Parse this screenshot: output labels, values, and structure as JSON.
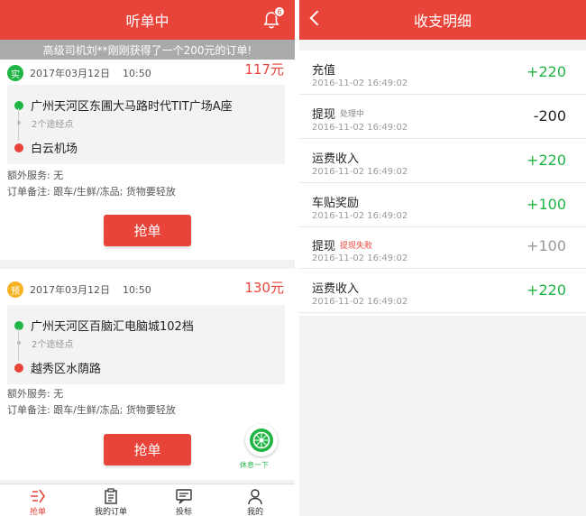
{
  "left": {
    "header_title": "听单中",
    "bell_badge": "6",
    "notice": "高级司机刘**刚刚获得了一个200元的订单!",
    "orders": [
      {
        "tag": "实",
        "tag_color": "#1fb544",
        "date": "2017年03月12日",
        "time": "10:50",
        "price": "117元",
        "from": "广州天河区东圃大马路时代TIT广场A座",
        "via": "2个途经点",
        "to": "白云机场",
        "extra_service_label": "额外服务:",
        "extra_service": "无",
        "note_label": "订单备注:",
        "note": "跟车/生鲜/冻品; 货物要轻放",
        "grab_label": "抢单"
      },
      {
        "tag": "预",
        "tag_color": "#f5b324",
        "date": "2017年03月12日",
        "time": "10:50",
        "price": "130元",
        "from": "广州天河区百脑汇电脑城102档",
        "via": "2个途经点",
        "to": "越秀区水荫路",
        "extra_service_label": "额外服务:",
        "extra_service": "无",
        "note_label": "订单备注:",
        "note": "跟车/生鲜/冻品; 货物要轻放",
        "grab_label": "抢单"
      }
    ],
    "rest_label": "休息一下",
    "tabs": [
      {
        "label": "抢单",
        "icon": "grab-order-icon"
      },
      {
        "label": "我的订单",
        "icon": "clipboard-icon"
      },
      {
        "label": "投标",
        "icon": "bid-icon"
      },
      {
        "label": "我的",
        "icon": "person-icon"
      }
    ]
  },
  "right": {
    "header_title": "收支明细",
    "rows": [
      {
        "title": "充值",
        "status": "",
        "time": "2016-11-02  16:49:02",
        "amount": "+220",
        "amount_color": "#1fb544"
      },
      {
        "title": "提现",
        "status": "处理中",
        "status_color": "#888888",
        "time": "2016-11-02  16:49:02",
        "amount": "-200",
        "amount_color": "#222222"
      },
      {
        "title": "运费收入",
        "status": "",
        "time": "2016-11-02  16:49:02",
        "amount": "+220",
        "amount_color": "#1fb544"
      },
      {
        "title": "车贴奖励",
        "status": "",
        "time": "2016-11-02  16:49:02",
        "amount": "+100",
        "amount_color": "#1fb544"
      },
      {
        "title": "提现",
        "status": "提现失败",
        "status_color": "#e8443a",
        "time": "2016-11-02  16:49:02",
        "amount": "+100",
        "amount_color": "#999999"
      },
      {
        "title": "运费收入",
        "status": "",
        "time": "2016-11-02  16:49:02",
        "amount": "+220",
        "amount_color": "#1fb544"
      }
    ]
  },
  "colors": {
    "brand_red": "#e8443a",
    "green": "#1fb544",
    "red_dot": "#e8443a"
  }
}
